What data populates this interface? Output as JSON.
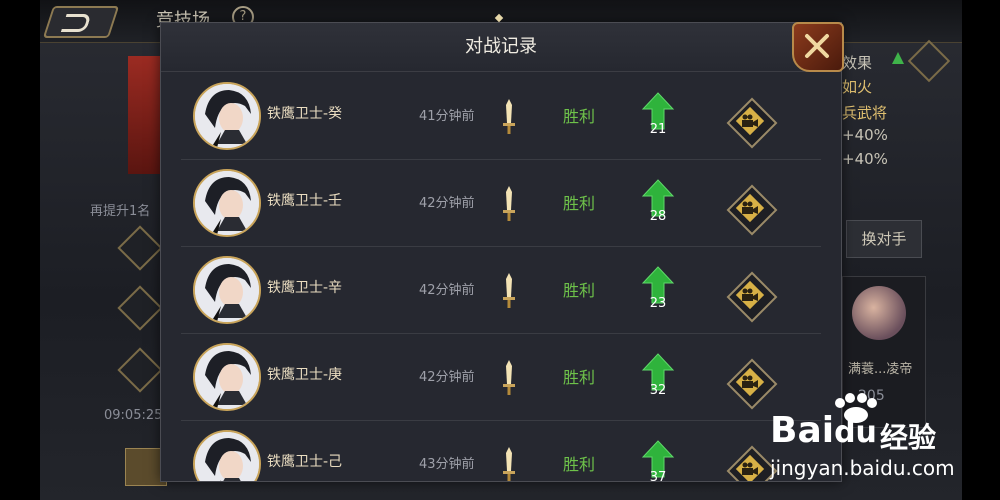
{
  "background": {
    "title": "竞技场",
    "help_symbol": "?",
    "left_hint": "再提升1名",
    "left_time": "09:05:25",
    "right_lines": [
      "效果",
      "如火",
      "兵武将",
      "+40%",
      "+40%"
    ],
    "swap_button": "换对手",
    "opponent_name": "满蓑...凌帝",
    "opponent_num": "205"
  },
  "modal": {
    "title": "对战记录",
    "close_icon": "close-x-icon",
    "rows": [
      {
        "name": "铁鹰卫士-癸",
        "time": "41分钟前",
        "result": "胜利",
        "delta": "21"
      },
      {
        "name": "铁鹰卫士-壬",
        "time": "42分钟前",
        "result": "胜利",
        "delta": "28"
      },
      {
        "name": "铁鹰卫士-辛",
        "time": "42分钟前",
        "result": "胜利",
        "delta": "23"
      },
      {
        "name": "铁鹰卫士-庚",
        "time": "42分钟前",
        "result": "胜利",
        "delta": "32"
      },
      {
        "name": "铁鹰卫士-己",
        "time": "43分钟前",
        "result": "胜利",
        "delta": "37"
      }
    ]
  },
  "watermark": {
    "brand": "Bai",
    "brand2": "du",
    "jingyan": "经验",
    "url": "jingyan.baidu.com"
  },
  "colors": {
    "win": "#6ec24a",
    "arrow_up": "#2fb33c",
    "gold": "#c9a45a"
  }
}
